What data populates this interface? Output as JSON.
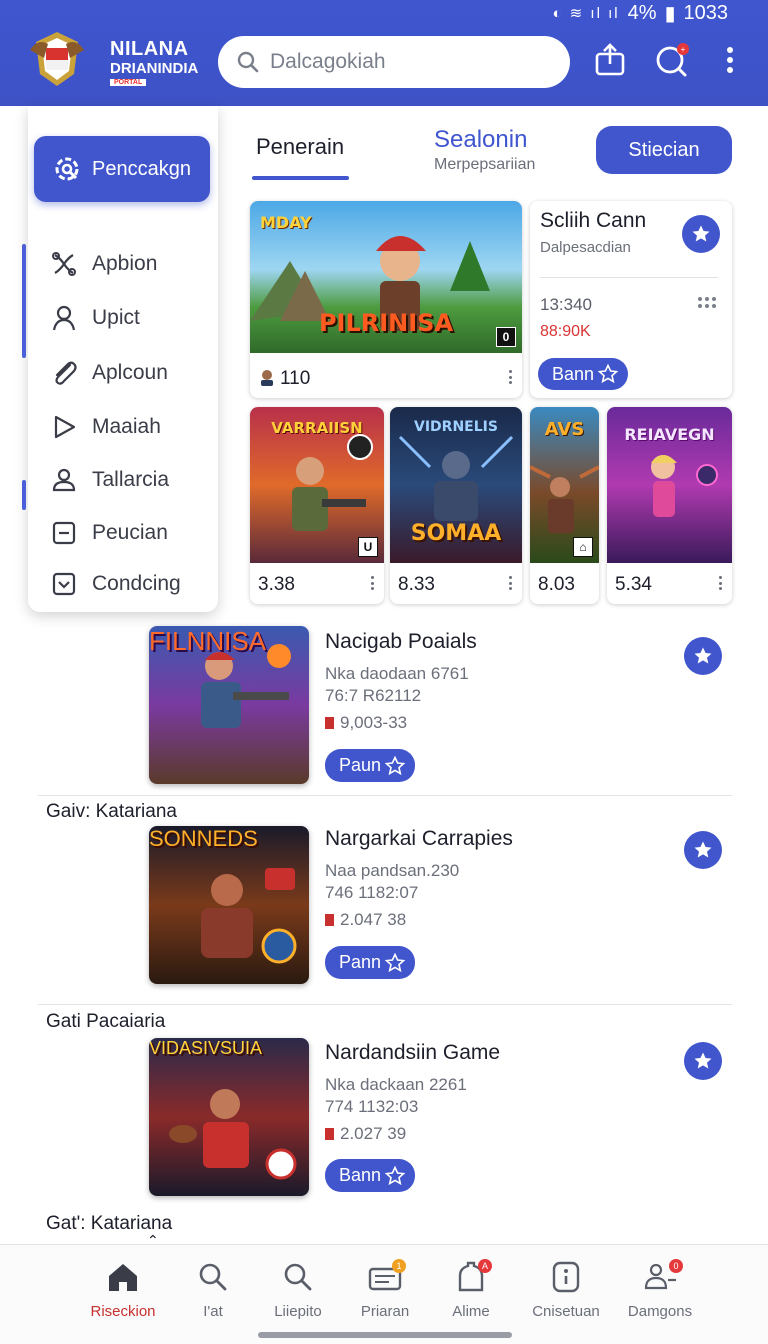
{
  "status_bar": {
    "battery": "4%",
    "time": "1033"
  },
  "header": {
    "logo": {
      "line1": "NILANA",
      "line2": "DRIANINDIA",
      "line3": "PORTAL"
    },
    "search": {
      "placeholder": "Dalcagokiah"
    }
  },
  "side_menu": {
    "primary_label": "Penccakgn",
    "items": [
      {
        "label": "Apbion",
        "icon": "scissors-icon"
      },
      {
        "label": "Upict",
        "icon": "user-icon"
      },
      {
        "label": "Aplcoun",
        "icon": "paperclip-icon"
      },
      {
        "label": "Maaiah",
        "icon": "play-icon"
      },
      {
        "label": "Tallarcia",
        "icon": "person-icon"
      },
      {
        "label": "Peucian",
        "icon": "minus-square-icon"
      },
      {
        "label": "Condcing",
        "icon": "check-square-icon"
      }
    ]
  },
  "tabs": {
    "tab1": "Penerain",
    "tab2": "Sealonin",
    "tab2_sub": "Merpepsariian",
    "action_button": "Stiecian"
  },
  "featured": {
    "art_top": "MDAY",
    "art_title": "PILRINISA",
    "art_badge": "0",
    "value": "110",
    "info": {
      "title": "Scliih Cann",
      "subtitle": "Dalpesacdian",
      "time": "13:340",
      "count": "88:90K",
      "button": "Bann"
    }
  },
  "small_cards": [
    {
      "art_title": "VARRAIISN",
      "badge": "U",
      "value": "3.38"
    },
    {
      "art_title": "SOMAA",
      "art_top": "VIDRNELIS",
      "value": "8.33"
    },
    {
      "art_title": "AVS",
      "value": "8.03"
    },
    {
      "art_title": "REIAVEGN",
      "value": "5.34"
    }
  ],
  "list": [
    {
      "art_title": "FILNNISA",
      "title": "Nacigab Poaials",
      "line1": "Nka daodaan 6761",
      "line2": "76:7 R62112",
      "stat": "9,003-33",
      "button": "Paun"
    },
    {
      "group": "Gaiv: Katariana",
      "art_title": "SONNEDS",
      "title": "Nargarkai Carrapies",
      "line1": "Naa pandsan.230",
      "line2": "746 1182:07",
      "stat": "2.047 38",
      "button": "Pann"
    },
    {
      "group": "Gati Pacaiaria",
      "art_title": "VIDASIVSUIA",
      "title": "Nardandsiin Game",
      "line1": "Nka dackaan 2261",
      "line2": "774 1132:03",
      "stat": "2.027 39",
      "button": "Bann"
    }
  ],
  "trailing_group": "Gat': Katariana",
  "bottom_nav": [
    {
      "label": "Riseckion",
      "icon": "home-icon",
      "active": true
    },
    {
      "label": "I'at",
      "icon": "search-icon"
    },
    {
      "label": "Liiepito",
      "icon": "search-icon"
    },
    {
      "label": "Priaran",
      "icon": "ticket-icon",
      "badge": "1"
    },
    {
      "label": "Alime",
      "icon": "alert-icon",
      "badge": "A"
    },
    {
      "label": "Cnisetuan",
      "icon": "info-icon"
    },
    {
      "label": "Damgons",
      "icon": "people-icon",
      "badge": "0"
    }
  ]
}
